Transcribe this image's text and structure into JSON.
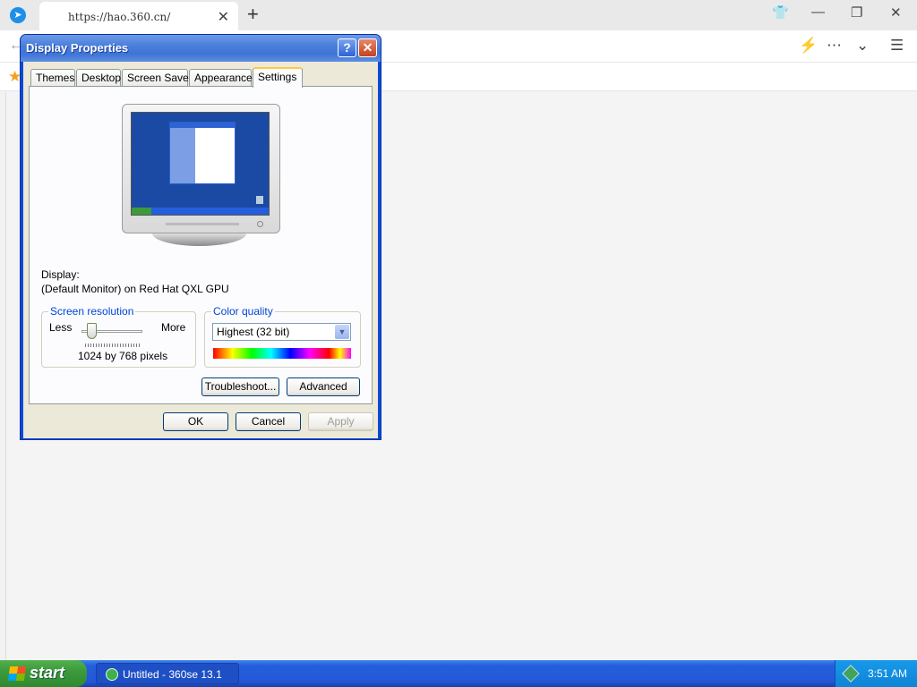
{
  "browser": {
    "tab_title": "https://hao.360.cn/",
    "tab_close": "✕",
    "new_tab": "+",
    "window_controls": {
      "shirt": "👕",
      "minimize": "—",
      "restore": "❐",
      "close": "✕"
    },
    "nav": {
      "back": "←",
      "bolt": "⚡",
      "more": "⋯",
      "dropdown": "⌄",
      "menu": "☰"
    },
    "fav_star": "★"
  },
  "dialog": {
    "title": "Display Properties",
    "help_button": "?",
    "close_button": "✕",
    "tabs": [
      {
        "label": "Themes"
      },
      {
        "label": "Desktop"
      },
      {
        "label": "Screen Saver"
      },
      {
        "label": "Appearance"
      },
      {
        "label": "Settings",
        "active": true
      }
    ],
    "display_label": "Display:",
    "display_value": "(Default Monitor) on Red Hat QXL GPU",
    "screen_resolution": {
      "title": "Screen resolution",
      "less": "Less",
      "more": "More",
      "value": "1024 by 768 pixels"
    },
    "color_quality": {
      "title": "Color quality",
      "selected": "Highest (32 bit)"
    },
    "troubleshoot_button": "Troubleshoot...",
    "advanced_button": "Advanced",
    "ok_button": "OK",
    "cancel_button": "Cancel",
    "apply_button": "Apply"
  },
  "taskbar": {
    "start_label": "start",
    "task_label": "Untitled - 360se 13.1",
    "clock": "3:51 AM"
  },
  "colors": {
    "xp_blue": "#0a4ad8",
    "dialog_face": "#ece9d8",
    "group_title": "#0046d5",
    "start_green": "#3c9a3c",
    "taskbar_blue": "#245edb"
  }
}
